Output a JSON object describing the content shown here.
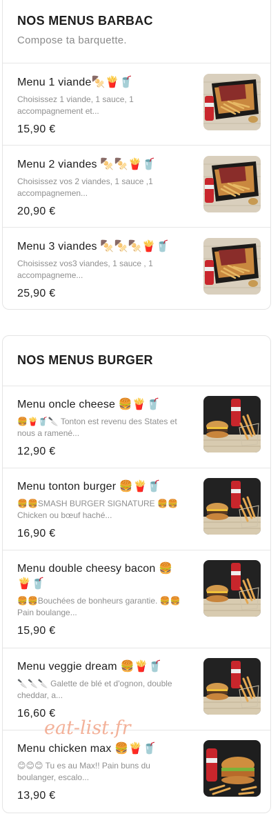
{
  "sections": [
    {
      "title": "NOS MENUS BARBAC",
      "subtitle": "Compose ta barquette.",
      "items": [
        {
          "name": "Menu 1 viande🍢🍟🥤",
          "description": "Choisissez 1 viande, 1 sauce, 1 accompagnement et...",
          "price": "15,90 €",
          "image": "barbecue-box-image"
        },
        {
          "name": "Menu 2 viandes 🍢🍢🍟🥤",
          "description": "Choisissez vos 2 viandes, 1 sauce ,1 accompagnemen...",
          "price": "20,90 €",
          "image": "barbecue-box-image"
        },
        {
          "name": "Menu 3 viandes 🍢🍢🍢🍟🥤",
          "description": "Choisissez vos3 viandes, 1 sauce , 1 accompagneme...",
          "price": "25,90 €",
          "image": "barbecue-box-image"
        }
      ]
    },
    {
      "title": "NOS MENUS BURGER",
      "subtitle": "",
      "items": [
        {
          "name": "Menu oncle cheese 🍔🍟🥤",
          "description": "🍔🍟🥤🔪 Tonton est revenu des States et nous a ramené...",
          "price": "12,90 €",
          "image": "burger-menu-image"
        },
        {
          "name": "Menu tonton burger 🍔🍟🥤",
          "description": "🍔🍔SMASH BURGER SIGNATURE 🍔🍔 Chicken ou bœuf haché...",
          "price": "16,90 €",
          "image": "burger-menu-image"
        },
        {
          "name": "Menu double cheesy bacon 🍔🍟🥤",
          "description": "🍔🍔Bouchées de bonheurs garantie. 🍔🍔 Pain boulange...",
          "price": "15,90 €",
          "image": "burger-menu-image"
        },
        {
          "name": "Menu veggie dream 🍔🍟🥤",
          "description": "🔪🔪🔪 Galette de blé et d'ognon, double cheddar, a...",
          "price": "16,60 €",
          "image": "burger-menu-image"
        },
        {
          "name": "Menu chicken max 🍔🍟🥤",
          "description": "😊😊😊 Tu es au Max!! Pain buns du boulanger, escalo...",
          "price": "13,90 €",
          "image": "chicken-burger-image"
        }
      ]
    }
  ],
  "watermark": "eat-list.fr"
}
